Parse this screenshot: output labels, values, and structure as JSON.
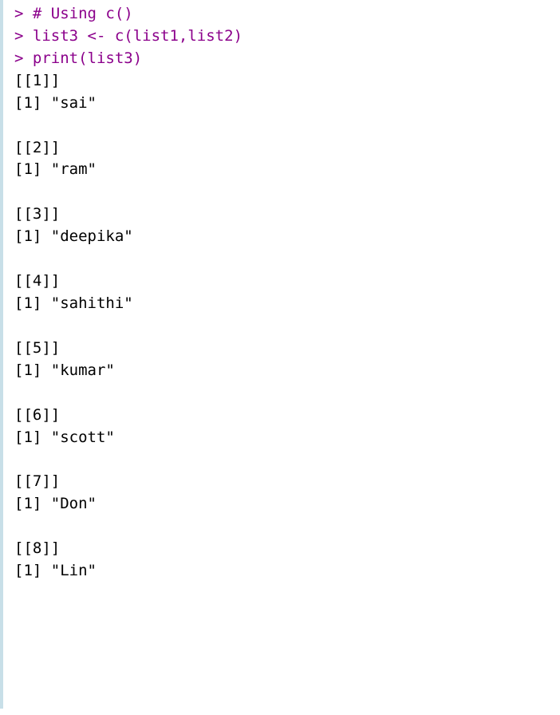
{
  "input": {
    "prompt": ">",
    "line1_comment": "# Using c()",
    "line2_code": "list3 <- c(list1,list2)",
    "line3_code": "print(list3)"
  },
  "output": {
    "items": [
      {
        "index": "[[1]]",
        "vec": "[1]",
        "value": "\"sai\""
      },
      {
        "index": "[[2]]",
        "vec": "[1]",
        "value": "\"ram\""
      },
      {
        "index": "[[3]]",
        "vec": "[1]",
        "value": "\"deepika\""
      },
      {
        "index": "[[4]]",
        "vec": "[1]",
        "value": "\"sahithi\""
      },
      {
        "index": "[[5]]",
        "vec": "[1]",
        "value": "\"kumar\""
      },
      {
        "index": "[[6]]",
        "vec": "[1]",
        "value": "\"scott\""
      },
      {
        "index": "[[7]]",
        "vec": "[1]",
        "value": "\"Don\""
      },
      {
        "index": "[[8]]",
        "vec": "[1]",
        "value": "\"Lin\""
      }
    ]
  }
}
